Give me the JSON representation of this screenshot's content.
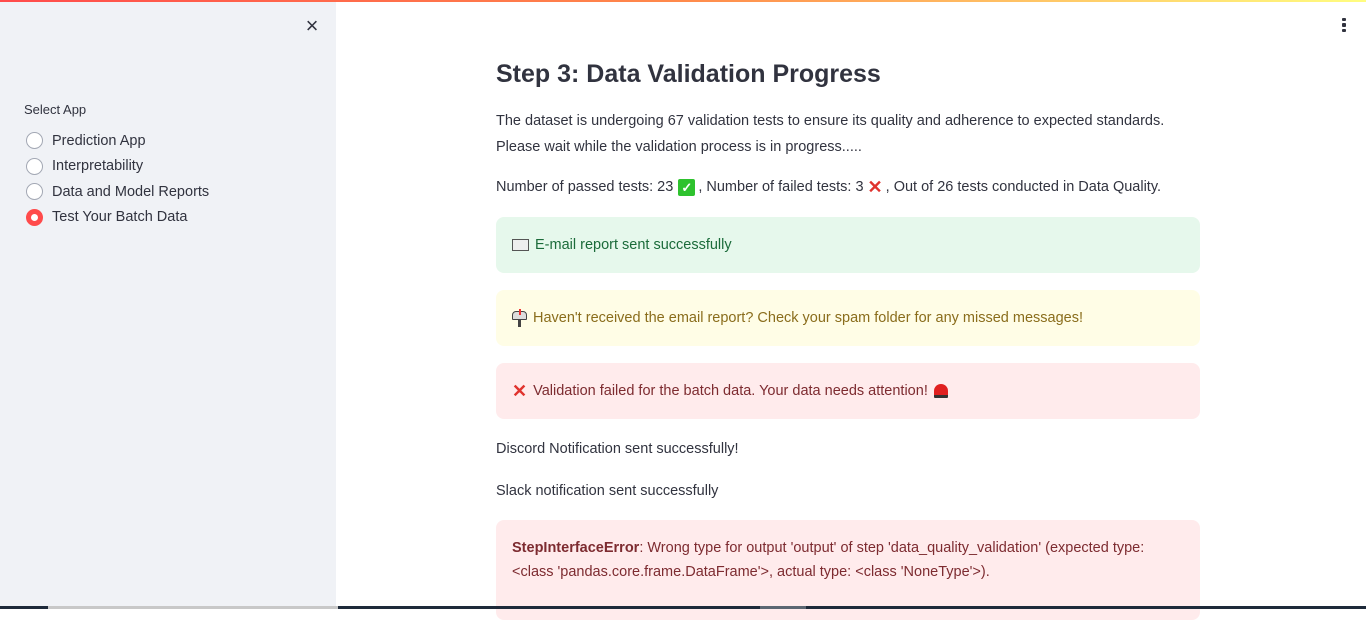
{
  "sidebar": {
    "close_icon": "×",
    "select_label": "Select App",
    "options": [
      {
        "label": "Prediction App",
        "selected": false
      },
      {
        "label": "Interpretability",
        "selected": false
      },
      {
        "label": "Data and Model Reports",
        "selected": false
      },
      {
        "label": "Test Your Batch Data",
        "selected": true
      }
    ]
  },
  "header": {
    "menu_icon": "kebab-menu"
  },
  "main": {
    "title": "Step 3: Data Validation Progress",
    "description_line1": "The dataset is undergoing 67 validation tests to ensure its quality and adherence to expected standards.",
    "description_line2": "Please wait while the validation process is in progress.....",
    "counts": {
      "passed_prefix": "Number of passed tests: 23",
      "passed_icon": "✓",
      "failed_prefix": ", Number of failed tests: 3",
      "failed_icon": "✕",
      "suffix": ", Out of 26 tests conducted in Data Quality."
    },
    "alerts": {
      "success": "E-mail report sent successfully",
      "warning": "Haven't received the email report? Check your spam folder for any missed messages!",
      "error_icon": "✕",
      "error": "Validation failed for the batch data. Your data needs attention!"
    },
    "discord_text": "Discord Notification sent successfully!",
    "slack_text": "Slack notification sent successfully",
    "exception": {
      "name": "StepInterfaceError",
      "message": ": Wrong type for output 'output' of step 'data_quality_validation' (expected type: <class 'pandas.core.frame.DataFrame'>, actual type: <class 'NoneType'>)."
    }
  },
  "colors": {
    "accent": "#ff4b4b",
    "success_bg": "#e6f8ec",
    "warning_bg": "#fffde6",
    "error_bg": "#ffebec"
  }
}
